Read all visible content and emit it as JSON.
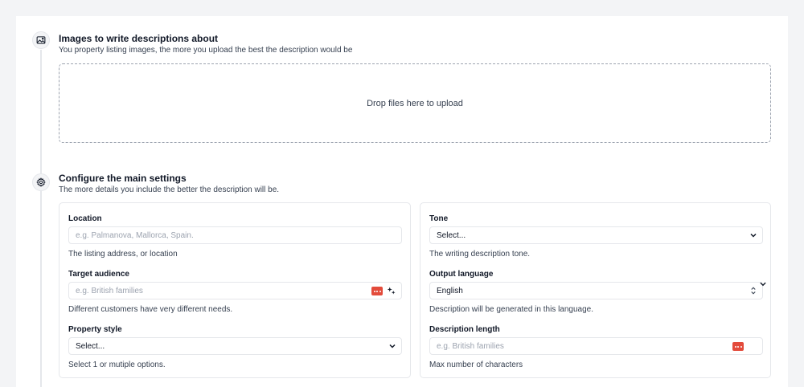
{
  "section_images": {
    "title": "Images to write descriptions about",
    "subtitle": "You property listing images, the more you upload the best the description would be",
    "dropzone_text": "Drop files here to upload"
  },
  "section_settings": {
    "title": "Configure the main settings",
    "subtitle": "The more details you include the better the description will be."
  },
  "left_panel": {
    "location": {
      "label": "Location",
      "placeholder": "e.g. Palmanova, Mallorca, Spain.",
      "help": "The listing address, or location"
    },
    "target_audience": {
      "label": "Target audience",
      "placeholder": "e.g. British families",
      "help": "Different customers have very different needs."
    },
    "property_style": {
      "label": "Property style",
      "selected": "Select...",
      "help": "Select 1 or mutiple options."
    }
  },
  "right_panel": {
    "tone": {
      "label": "Tone",
      "selected": "Select...",
      "help": "The writing description tone."
    },
    "output_language": {
      "label": "Output language",
      "selected": "English",
      "help": "Description will be generated in this language."
    },
    "description_length": {
      "label": "Description length",
      "placeholder": "e.g. British families",
      "help": "Max number of characters"
    }
  },
  "colors": {
    "accent_red": "#e34b3b",
    "border": "#e5e7eb",
    "background": "#f3f4f6"
  },
  "icons": {
    "images_step": "image-icon",
    "settings_step": "gear-icon",
    "dots_button": "more-dots-icon",
    "sparkle": "sparkle-icon",
    "select_chevron": "chevron-down-icon",
    "updown": "chevron-up-down-icon"
  }
}
